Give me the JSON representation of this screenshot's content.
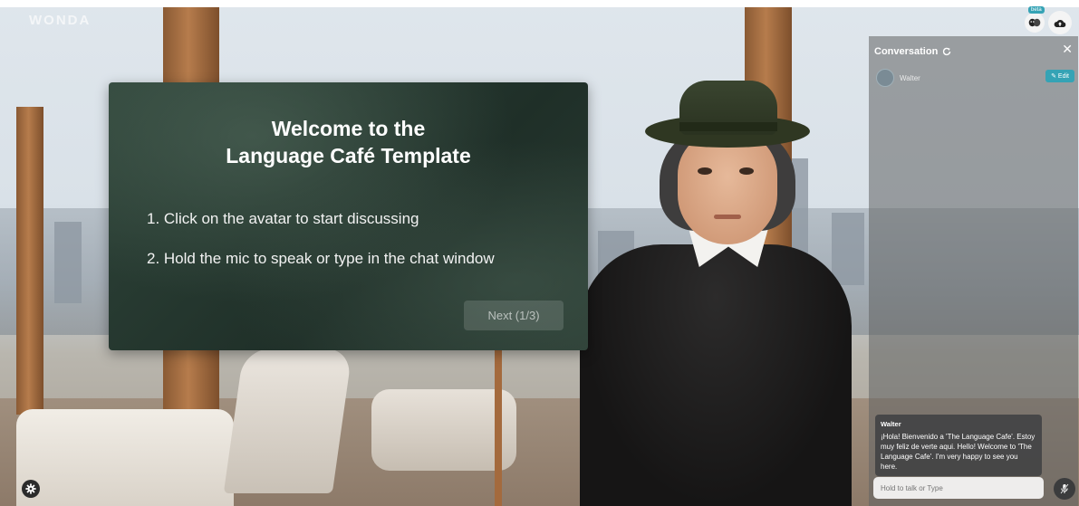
{
  "app": {
    "logo_text": "WONDA"
  },
  "welcome": {
    "title_line1": "Welcome to the",
    "title_line2": "Language Café Template",
    "step1": "1. Click on the avatar to start discussing",
    "step2": "2. Hold the mic to speak or type in the chat window",
    "next_label": "Next (1/3)"
  },
  "top_icons": {
    "beta_label": "beta"
  },
  "conversation": {
    "title": "Conversation",
    "character_name": "Walter",
    "edit_label": "✎ Edit",
    "message": {
      "sender": "Walter",
      "text": "¡Hola! Bienvenido a 'The Language Cafe'. Estoy muy feliz de verte aqui. Hello! Welcome to 'The Language Cafe'. I'm very happy to see you here."
    },
    "input_placeholder": "Hold to talk or Type"
  },
  "colors": {
    "accent": "#35a3b5",
    "panel_bg": "#2a3c33"
  }
}
